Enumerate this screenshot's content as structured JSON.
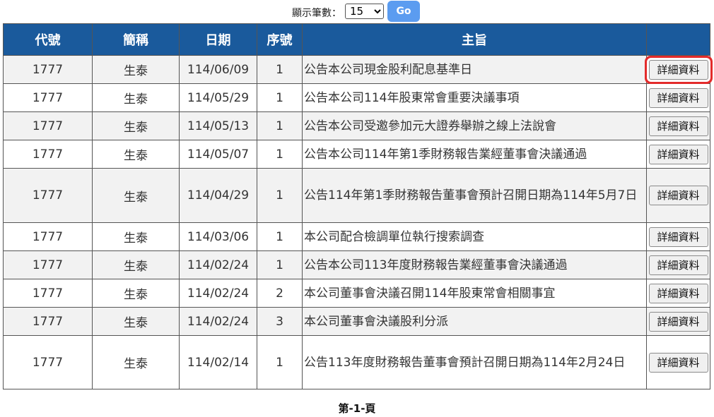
{
  "toolbar": {
    "label": "顯示筆數：",
    "page_size": "15",
    "page_size_options": [
      "15"
    ],
    "go_label": "Go"
  },
  "table": {
    "headers": [
      "代號",
      "簡稱",
      "日期",
      "序號",
      "主旨",
      ""
    ],
    "rows": [
      {
        "code": "1777",
        "name": "生泰",
        "date": "114/06/09",
        "seq": "1",
        "subject": "公告本公司現金股利配息基準日",
        "action": "詳細資料"
      },
      {
        "code": "1777",
        "name": "生泰",
        "date": "114/05/29",
        "seq": "1",
        "subject": "公告本公司114年股東常會重要決議事項",
        "action": "詳細資料"
      },
      {
        "code": "1777",
        "name": "生泰",
        "date": "114/05/13",
        "seq": "1",
        "subject": "公告本公司受邀參加元大證券舉辦之線上法說會",
        "action": "詳細資料"
      },
      {
        "code": "1777",
        "name": "生泰",
        "date": "114/05/07",
        "seq": "1",
        "subject": "公告本公司114年第1季財務報告業經董事會決議通過",
        "action": "詳細資料"
      },
      {
        "code": "1777",
        "name": "生泰",
        "date": "114/04/29",
        "seq": "1",
        "subject": "公告114年第1季財務報告董事會預計召開日期為114年5月7日",
        "action": "詳細資料"
      },
      {
        "code": "1777",
        "name": "生泰",
        "date": "114/03/06",
        "seq": "1",
        "subject": "本公司配合檢調單位執行搜索調查",
        "action": "詳細資料"
      },
      {
        "code": "1777",
        "name": "生泰",
        "date": "114/02/24",
        "seq": "1",
        "subject": "公告本公司113年度財務報告業經董事會決議通過",
        "action": "詳細資料"
      },
      {
        "code": "1777",
        "name": "生泰",
        "date": "114/02/24",
        "seq": "2",
        "subject": "本公司董事會決議召開114年股東常會相關事宜",
        "action": "詳細資料"
      },
      {
        "code": "1777",
        "name": "生泰",
        "date": "114/02/24",
        "seq": "3",
        "subject": "本公司董事會決議股利分派",
        "action": "詳細資料"
      },
      {
        "code": "1777",
        "name": "生泰",
        "date": "114/02/14",
        "seq": "1",
        "subject": "公告113年度財務報告董事會預計召開日期為114年2月24日",
        "action": "詳細資料"
      }
    ]
  },
  "pager": {
    "label": "第-1-頁"
  },
  "colors": {
    "header_bg": "#1a5a9c",
    "highlight": "#e32b2b",
    "go_button": "#5b9cf0"
  }
}
